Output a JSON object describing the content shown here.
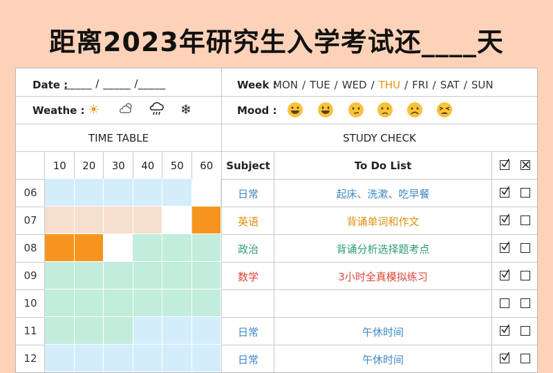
{
  "title": "距离2023年研究生入学考试还____天",
  "header": {
    "date_label": "Date :",
    "date_blank": "_____ / _____ /_____",
    "week_label": "Week :",
    "weekdays": [
      "MON",
      "TUE",
      "WED",
      "THU",
      "FRI",
      "SAT",
      "SUN"
    ],
    "active_weekday": "THU",
    "weather_label": "Weathe :",
    "weather_icons": [
      "sun-icon",
      "cloudy-sun-icon",
      "rain-cloud-icon",
      "snowflake-icon"
    ],
    "mood_label": "Mood :",
    "mood_icons": [
      "grinning-face-icon",
      "smiling-face-icon",
      "neutral-face-icon",
      "slightly-sad-face-icon",
      "sad-face-icon",
      "distressed-face-icon"
    ]
  },
  "time_table": {
    "title": "TIME TABLE",
    "minutes": [
      "10",
      "20",
      "30",
      "40",
      "50",
      "60"
    ],
    "rows": [
      {
        "hour": "06",
        "cells": [
          "blue",
          "blue",
          "blue",
          "blue",
          "blue",
          "white"
        ]
      },
      {
        "hour": "07",
        "cells": [
          "peach",
          "peach",
          "peach",
          "peach",
          "white",
          "orange"
        ]
      },
      {
        "hour": "08",
        "cells": [
          "orange",
          "orange",
          "white",
          "green",
          "green",
          "green"
        ]
      },
      {
        "hour": "09",
        "cells": [
          "green",
          "green",
          "green",
          "green",
          "green",
          "green"
        ]
      },
      {
        "hour": "10",
        "cells": [
          "green",
          "green",
          "green",
          "green",
          "green",
          "green"
        ]
      },
      {
        "hour": "11",
        "cells": [
          "green",
          "green",
          "green",
          "blue",
          "blue",
          "blue"
        ]
      },
      {
        "hour": "12",
        "cells": [
          "blue",
          "blue",
          "blue",
          "blue",
          "blue",
          "blue"
        ]
      }
    ]
  },
  "study_check": {
    "title": "STUDY CHECK",
    "subject_header": "Subject",
    "todo_header": "To Do List",
    "rows": [
      {
        "subject": "日常",
        "todo": "起床、洗漱、吃早餐",
        "color": "#3f87c7",
        "done": true
      },
      {
        "subject": "英语",
        "todo": "背诵单词和作文",
        "color": "#e0900e",
        "done": true
      },
      {
        "subject": "政治",
        "todo": "背诵分析选择题考点",
        "color": "#2e9a72",
        "done": true
      },
      {
        "subject": "数学",
        "todo": "3小时全真模拟练习",
        "color": "#d9443a",
        "done": true
      },
      {
        "subject": "",
        "todo": "",
        "color": "#333333",
        "done": false
      },
      {
        "subject": "日常",
        "todo": "午休时间",
        "color": "#3f87c7",
        "done": true
      },
      {
        "subject": "日常",
        "todo": "午休时间",
        "color": "#3f87c7",
        "done": true
      }
    ]
  },
  "colors": {
    "blue": "#d3eefa",
    "peach": "#f7dfd0",
    "orange": "#f7941d",
    "green": "#c2ecdc",
    "white": "#ffffff",
    "background": "#fdd2b8"
  }
}
